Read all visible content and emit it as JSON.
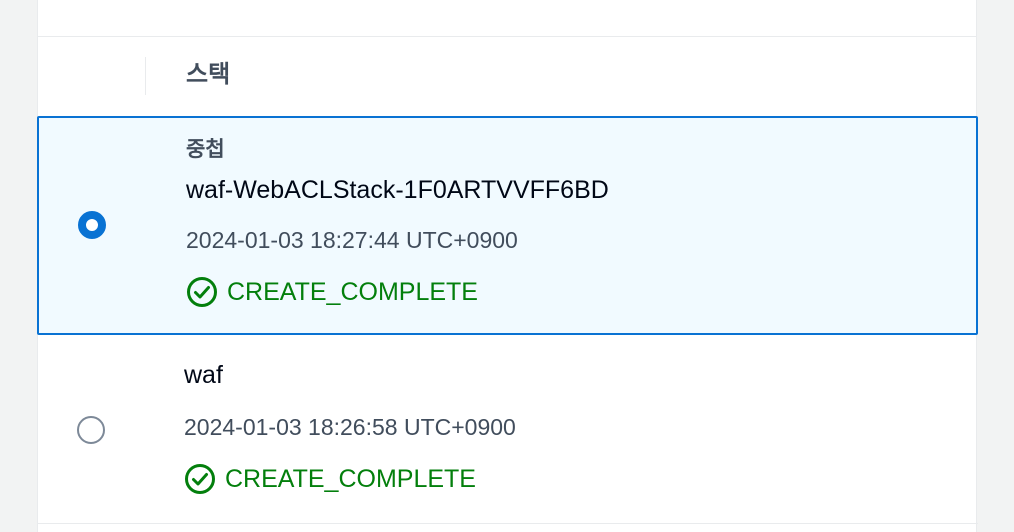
{
  "table": {
    "header": {
      "column_label": "스택"
    },
    "rows": [
      {
        "selected": true,
        "nested_tag": "중첩",
        "stack_name": "waf-WebACLStack-1F0ARTVVFF6BD",
        "created_time": "2024-01-03 18:27:44 UTC+0900",
        "status": "CREATE_COMPLETE",
        "status_icon": "check-circle-icon"
      },
      {
        "selected": false,
        "stack_name": "waf",
        "created_time": "2024-01-03 18:26:58 UTC+0900",
        "status": "CREATE_COMPLETE",
        "status_icon": "check-circle-icon"
      }
    ]
  },
  "colors": {
    "selected_border": "#0972d3",
    "selected_background": "#f1faff",
    "status_success": "#037f0c"
  }
}
